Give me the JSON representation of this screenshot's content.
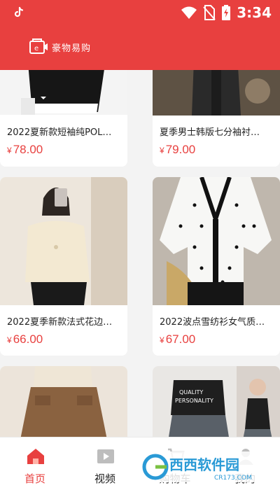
{
  "status_bar": {
    "time": "3:34"
  },
  "app": {
    "logo_text": "豪物易购"
  },
  "products": [
    {
      "title": "2022夏新款短袖纯POL…",
      "price": "78.00"
    },
    {
      "title": "夏季男士韩版七分袖衬…",
      "price": "79.00"
    },
    {
      "title": "2022夏季新款法式花边…",
      "price": "66.00"
    },
    {
      "title": "2022波点雪纺衫女气质…",
      "price": "67.00"
    },
    {
      "title": "",
      "price": ""
    },
    {
      "title": "",
      "price": ""
    }
  ],
  "currency_symbol": "¥",
  "tab_bar": {
    "tabs": [
      {
        "label": "首页",
        "icon": "home-icon",
        "active": true
      },
      {
        "label": "视频",
        "icon": "video-icon",
        "active": false
      },
      {
        "label": "购物车",
        "icon": "cart-icon",
        "active": false
      },
      {
        "label": "我的",
        "icon": "profile-icon",
        "active": false
      }
    ]
  },
  "watermark": {
    "text": "西西软件园",
    "url": "CR173.COM"
  },
  "colors": {
    "brand": "#e8403f",
    "text": "#222222",
    "background": "#f3f3f3"
  }
}
